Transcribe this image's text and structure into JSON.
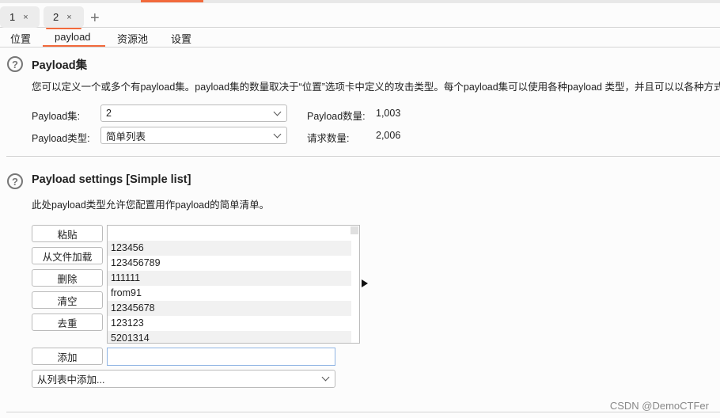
{
  "tabs": [
    {
      "label": "1",
      "close": "×"
    },
    {
      "label": "2",
      "close": "×",
      "active": true
    }
  ],
  "new_tab": "+",
  "subtabs": [
    "位置",
    "payload",
    "资源池",
    "设置"
  ],
  "active_subtab": "payload",
  "accent_color": "#f26a3c",
  "payload_sets": {
    "help_icon": "?",
    "title": "Payload集",
    "description": "您可以定义一个或多个有payload集。payload集的数量取决于“位置”选项卡中定义的攻击类型。每个payload集可以使用各种payload 类型，并且可以以各种方式定",
    "set_label": "Payload集:",
    "set_value": "2",
    "type_label": "Payload类型:",
    "type_value": "简单列表",
    "count_label": "Payload数量:",
    "count_value": "1,003",
    "requests_label": "请求数量:",
    "requests_value": "2,006"
  },
  "payload_settings": {
    "help_icon": "?",
    "title": "Payload settings [Simple list]",
    "description": "此处payload类型允许您配置用作payload的简单清单。",
    "buttons": {
      "paste": "粘贴",
      "load": "从文件加载",
      "remove": "删除",
      "clear": "清空",
      "dedupe": "去重",
      "add": "添加"
    },
    "items": [
      "",
      "123456",
      "123456789",
      "111111",
      "from91",
      "12345678",
      "123123",
      "5201314"
    ],
    "add_input_value": "",
    "add_from_list": "从列表中添加..."
  },
  "watermark": "CSDN @DemoCTFer"
}
